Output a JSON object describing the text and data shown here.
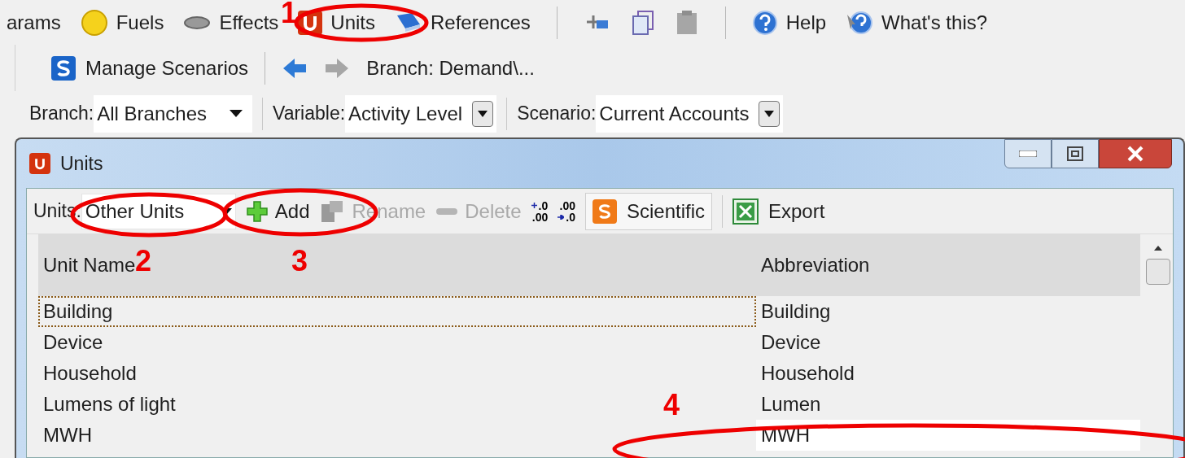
{
  "main_toolbar": [
    {
      "kind": "text",
      "label": "arams"
    },
    {
      "kind": "fuels",
      "label": "Fuels"
    },
    {
      "kind": "effects",
      "label": "Effects"
    },
    {
      "kind": "units",
      "label": "Units"
    },
    {
      "kind": "references",
      "label": "References"
    },
    {
      "kind": "separator"
    },
    {
      "kind": "pin"
    },
    {
      "kind": "copy"
    },
    {
      "kind": "paste"
    },
    {
      "kind": "separator"
    },
    {
      "kind": "help",
      "label": "Help"
    },
    {
      "kind": "whats-this",
      "label": "What's this?"
    }
  ],
  "nav_bar": {
    "manage_label": "Manage Scenarios",
    "back_enabled": true,
    "forward_enabled": false,
    "breadcrumb": "Branch: Demand\\..."
  },
  "filters": [
    {
      "label": "Branch:",
      "value": "All Branches"
    },
    {
      "label": "Variable:",
      "value": "Activity Level"
    },
    {
      "label": "Scenario:",
      "value": "Current Accounts"
    }
  ],
  "dialog": {
    "title": "Units",
    "toolbar": [
      {
        "kind": "dropdown",
        "label": "Units:",
        "value": "Other Units",
        "disabled": false
      },
      {
        "kind": "add",
        "label": "Add",
        "disabled": false
      },
      {
        "kind": "rename",
        "label": "Rename",
        "disabled": true
      },
      {
        "kind": "delete",
        "label": "Delete",
        "disabled": true
      },
      {
        "kind": "more-decimals",
        "top": ".0",
        "bottom": ".00",
        "disabled": false
      },
      {
        "kind": "fewer-decimals",
        "top": ".00",
        "bottom": ".0",
        "disabled": false
      },
      {
        "kind": "scientific",
        "label": "Scientific",
        "disabled": false,
        "pressed": true
      },
      {
        "kind": "export",
        "label": "Export",
        "disabled": false
      }
    ],
    "table": {
      "columns": [
        "Unit Name",
        "Abbreviation"
      ],
      "rows": [
        {
          "cells": [
            "Building",
            "Building"
          ],
          "focused": true,
          "editing": false
        },
        {
          "cells": [
            "Device",
            "Device"
          ],
          "focused": false,
          "editing": false
        },
        {
          "cells": [
            "Household",
            "Household"
          ],
          "focused": false,
          "editing": false
        },
        {
          "cells": [
            "Lumens of light",
            "Lumen"
          ],
          "focused": false,
          "editing": false
        },
        {
          "cells": [
            "MWH",
            "MWH"
          ],
          "focused": false,
          "editing": true
        }
      ]
    }
  },
  "annotations": [
    {
      "label": "1"
    },
    {
      "label": "2"
    },
    {
      "label": "3"
    },
    {
      "label": "4"
    }
  ]
}
